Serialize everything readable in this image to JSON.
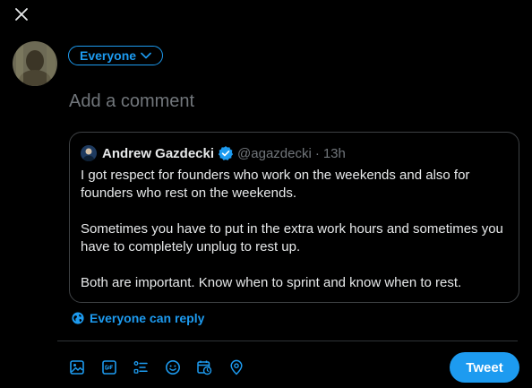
{
  "compose": {
    "audience_label": "Everyone",
    "placeholder": "Add a comment"
  },
  "quoted_tweet": {
    "author_name": "Andrew Gazdecki",
    "author_handle": "@agazdecki",
    "separator": "·",
    "time": "13h",
    "paragraphs": [
      "I got respect for founders who work on the weekends and also for founders who rest on the weekends.",
      "Sometimes you have to put in the extra work hours and sometimes you have to completely unplug to rest up.",
      "Both are important. Know when to sprint and know when to rest."
    ]
  },
  "reply_setting": {
    "label": "Everyone can reply"
  },
  "toolbar": {
    "icons": [
      "image-icon",
      "gif-icon",
      "poll-icon",
      "emoji-icon",
      "schedule-icon",
      "location-icon"
    ],
    "tweet_label": "Tweet"
  },
  "colors": {
    "accent": "#1d9bf0",
    "background": "#000000",
    "text": "#e7e9ea",
    "muted": "#71767b",
    "border": "#2f3336"
  }
}
